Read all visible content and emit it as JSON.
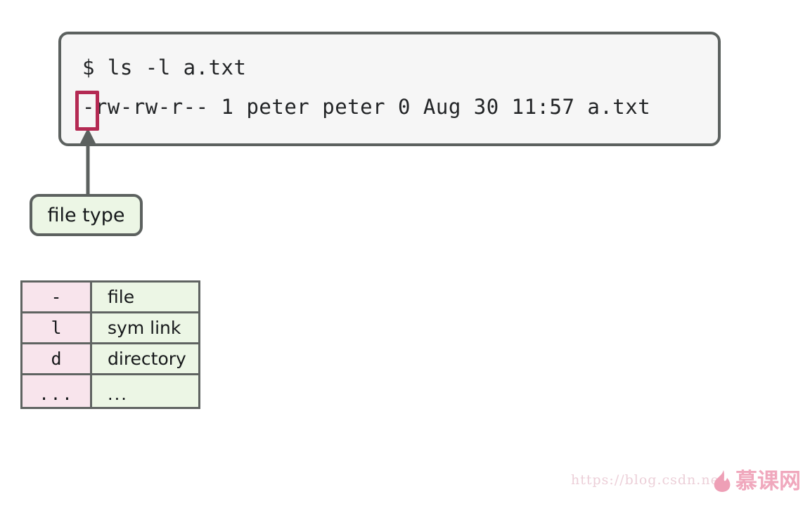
{
  "terminal": {
    "command": "$ ls -l a.txt",
    "output": "-rw-rw-r-- 1 peter peter 0 Aug 30 11:57 a.txt",
    "background_color": "#f6f6f6",
    "border_color": "#5c615f"
  },
  "highlight": {
    "target_character": "-",
    "color": "#b42a53"
  },
  "callout": {
    "label": "file type",
    "background_color": "#ecf6e5",
    "border_color": "#5c615f"
  },
  "legend_table": {
    "code_column_color": "#f8e4ec",
    "desc_column_color": "#ecf6e5",
    "border_color": "#5f6361",
    "rows": [
      {
        "code": "-",
        "desc": "file"
      },
      {
        "code": "l",
        "desc": "sym link"
      },
      {
        "code": "d",
        "desc": "directory"
      },
      {
        "code": "...",
        "desc": "..."
      }
    ]
  },
  "watermark": {
    "url": "https://blog.csdn.net",
    "logo_text": "慕课网",
    "color": "#eccfd8",
    "logo_color": "#f0a8bd"
  }
}
